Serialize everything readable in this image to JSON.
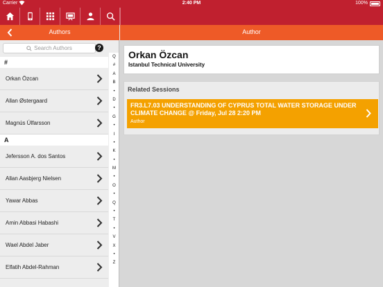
{
  "status_bar": {
    "carrier": "Carrier",
    "time": "2:40 PM",
    "battery": "100%"
  },
  "toolbar": {
    "icons": [
      "home-icon",
      "phone-icon",
      "grid-icon",
      "presentation-icon",
      "user-icon",
      "search-icon"
    ]
  },
  "left_nav": {
    "title": "Authors"
  },
  "right_nav": {
    "title": "Author"
  },
  "search": {
    "placeholder": "Search Authors",
    "help": "?"
  },
  "list": {
    "sections": [
      {
        "header": "#",
        "items": [
          "Orkan Özcan",
          "Allan Østergaard",
          "Magnús Úlfarsson"
        ]
      },
      {
        "header": "A",
        "items": [
          "Jefersson A. dos Santos",
          "Allan Aasbjerg Nielsen",
          "Yawar Abbas",
          "Amin Abbasi Habashi",
          "Wael Abdel Jaber",
          "Elfatih Abdel-Rahman"
        ]
      }
    ]
  },
  "index": [
    "Q",
    "#",
    "A",
    "B",
    "•",
    "D",
    "•",
    "G",
    "•",
    "I",
    "•",
    "K",
    "•",
    "M",
    "•",
    "O",
    "•",
    "Q",
    "•",
    "T",
    "•",
    "V",
    "X",
    "•",
    "Z"
  ],
  "author": {
    "name": "Orkan Özcan",
    "affiliation": "Istanbul Technical University"
  },
  "related": {
    "header": "Related Sessions",
    "sessions": [
      {
        "title": "FR3.L7.03 UNDERSTANDING OF CYPRUS TOTAL WATER STORAGE UNDER CLIMATE CHANGE @ Friday, Jul 28 2:20 PM",
        "role": "Author"
      }
    ]
  },
  "colors": {
    "toolbar": "#c0202f",
    "navbar": "#ee5a27",
    "session": "#f4a100"
  }
}
